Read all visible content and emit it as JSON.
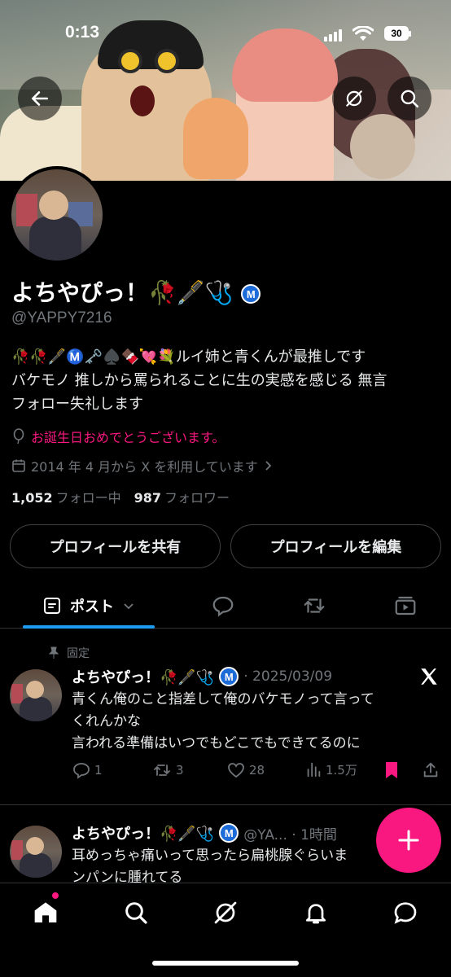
{
  "status_bar": {
    "time": "0:13",
    "battery": "30"
  },
  "profile": {
    "display_name": "よちやぴっ！🥀🖋️🩺",
    "verified_mark": "M",
    "handle": "@YAPPY7216",
    "bio_line1": "🥀🥀🖋️Ⓜ️🗝️♠️🍫💘💐ルイ姉と青くんが最推しです",
    "bio_line2": "バケモノ 推しから罵られることに生の実感を感じる 無言",
    "bio_line3": "フォロー失礼します",
    "birthday": "お誕生日おめでとうございます。",
    "joined": "2014 年 4 月から X を利用しています",
    "following_count": "1,052",
    "following_label": "フォロー中",
    "followers_count": "987",
    "followers_label": "フォロワー"
  },
  "buttons": {
    "share_profile": "プロフィールを共有",
    "edit_profile": "プロフィールを編集"
  },
  "tabs": {
    "posts_label": "ポスト"
  },
  "pinned_post": {
    "pinned_label": "固定",
    "author": "よちやぴっ！🥀🖋️🩺",
    "verified_mark": "M",
    "date": "· 2025/03/09",
    "text_line1": "青くん俺のこと指差して俺のバケモノって言って",
    "text_line2": "くれんかな",
    "text_line3": "言われる準備はいつでもどこでもできてるのに",
    "replies": "1",
    "reposts": "3",
    "likes": "28",
    "views": "1.5万"
  },
  "second_post": {
    "author": "よちやぴっ！🥀🖋️🩺",
    "verified_mark": "M",
    "handle_time": "@YA... · 1時間",
    "text_line1": "耳めっちゃ痛いって思ったら扁桃腺ぐらいま",
    "text_line2": "ンパンに腫れてる"
  },
  "colors": {
    "accent": "#1d9bf0",
    "pink": "#f91880",
    "muted": "#71767b"
  }
}
